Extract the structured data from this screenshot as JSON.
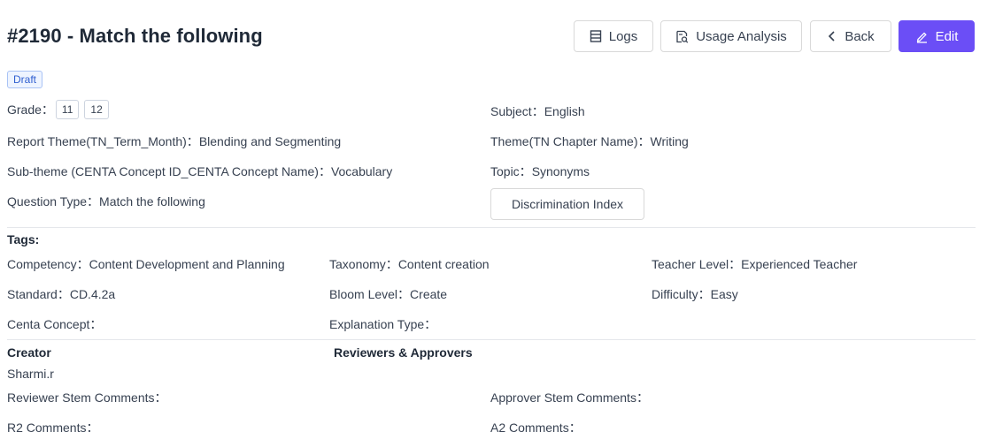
{
  "header": {
    "title": "#2190 - Match the following",
    "buttons": {
      "logs": "Logs",
      "usage": "Usage Analysis",
      "back": "Back",
      "edit": "Edit"
    }
  },
  "status": "Draft",
  "details": {
    "grade_label": "Grade：",
    "grades": [
      "11",
      "12"
    ],
    "subject_label": "Subject：",
    "subject": "English",
    "report_theme_label": "Report Theme(TN_Term_Month)：",
    "report_theme": "Blending and Segmenting",
    "theme_label": "Theme(TN Chapter Name)：",
    "theme": "Writing",
    "subtheme_label": "Sub-theme (CENTA Concept ID_CENTA Concept Name)：",
    "subtheme": "Vocabulary",
    "topic_label": "Topic：",
    "topic": "Synonyms",
    "qtype_label": "Question Type：",
    "qtype": "Match the following",
    "discrimination_index": "Discrimination Index"
  },
  "tags": {
    "heading": "Tags:",
    "competency_label": "Competency：",
    "competency": "Content Development and Planning",
    "taxonomy_label": "Taxonomy：",
    "taxonomy": "Content creation",
    "teacher_level_label": "Teacher Level：",
    "teacher_level": "Experienced Teacher",
    "standard_label": "Standard：",
    "standard": "CD.4.2a",
    "bloom_label": "Bloom Level：",
    "bloom": "Create",
    "difficulty_label": "Difficulty：",
    "difficulty": "Easy",
    "centa_label": "Centa Concept：",
    "explanation_label": "Explanation Type："
  },
  "people": {
    "creator_heading": "Creator",
    "creator": "Sharmi.r",
    "reviewers_heading": "Reviewers & Approvers",
    "reviewer_stem_label": "Reviewer Stem Comments：",
    "approver_stem_label": "Approver Stem Comments：",
    "r2_label": "R2 Comments：",
    "a2_label": "A2 Comments："
  },
  "colors": {
    "primary": "#6b4ef6",
    "badge_text": "#2f5fd0",
    "badge_bg": "#eef4ff"
  },
  "icons": [
    "logs-icon",
    "usage-analysis-icon",
    "chevron-left-icon",
    "edit-pen-icon"
  ]
}
